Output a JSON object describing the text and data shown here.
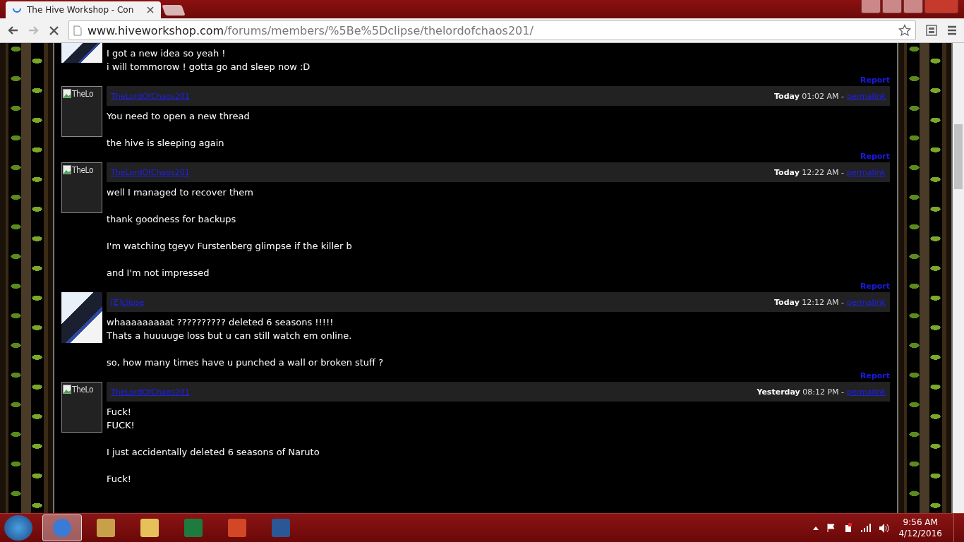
{
  "browser": {
    "tabs": [
      {
        "kind": "page",
        "title": "The Hive Workshop - Con",
        "selected": true
      },
      {
        "kind": "new",
        "selected": false
      }
    ],
    "address": {
      "domain": "www.hiveworkshop.com",
      "path": "/forums/members/%5Be%5Dclipse/thelordofchaos201/"
    }
  },
  "posts": [
    {
      "kind": "continued",
      "avatar": {
        "kind": "photo"
      },
      "paragraphs": [
        [
          "I got a new idea so yeah !",
          "i will tommorow ! gotta go and sleep now :D"
        ]
      ],
      "report": "Report"
    },
    {
      "kind": "post",
      "avatar": {
        "kind": "broken",
        "alt": "TheLo"
      },
      "author": "TheLordOfChaos201",
      "day": "Today",
      "time": "01:02 AM",
      "separator": "-",
      "permalink": "permalink",
      "paragraphs": [
        [
          "You need to open a new thread"
        ],
        [
          "the hive is sleeping again"
        ]
      ],
      "report": "Report"
    },
    {
      "kind": "post",
      "avatar": {
        "kind": "broken",
        "alt": "TheLo"
      },
      "author": "TheLordOfChaos201",
      "day": "Today",
      "time": "12:22 AM",
      "separator": "-",
      "permalink": "permalink",
      "paragraphs": [
        [
          "well I managed to recover them"
        ],
        [
          "thank goodness for backups"
        ],
        [
          "I'm watching tgeyv Furstenberg glimpse if the killer b"
        ],
        [
          "and I'm not impressed"
        ]
      ],
      "report": "Report"
    },
    {
      "kind": "post",
      "avatar": {
        "kind": "photo"
      },
      "author": "[E]clipse",
      "day": "Today",
      "time": "12:12 AM",
      "separator": "-",
      "permalink": "permalink",
      "paragraphs": [
        [
          "whaaaaaaaaat ?????????? deleted 6 seasons !!!!!",
          "Thats a huuuuge loss but u can still watch em online."
        ],
        [
          "so, how many times have u punched a wall or broken stuff ?"
        ]
      ],
      "report": "Report"
    },
    {
      "kind": "post",
      "avatar": {
        "kind": "broken",
        "alt": "TheLo"
      },
      "author": "TheLordOfChaos201",
      "day": "Yesterday",
      "time": "08:12 PM",
      "separator": "-",
      "permalink": "permalink",
      "paragraphs": [
        [
          "Fuck!",
          "FUCK!"
        ],
        [
          "I just accidentally deleted 6 seasons of Naruto"
        ],
        [
          "Fuck!"
        ]
      ]
    }
  ],
  "taskbar": {
    "items": [
      {
        "kind": "chrome",
        "selected": true
      },
      {
        "kind": "paint",
        "selected": false
      },
      {
        "kind": "folder",
        "selected": false
      },
      {
        "kind": "excel",
        "selected": false
      },
      {
        "kind": "powerpoint",
        "selected": false
      },
      {
        "kind": "word",
        "selected": false
      }
    ],
    "time": "9:56 AM",
    "date": "4/12/2016"
  }
}
